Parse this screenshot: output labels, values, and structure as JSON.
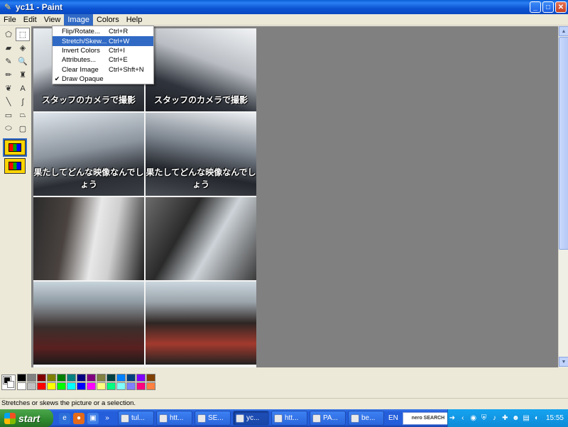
{
  "window": {
    "title": "yc11 - Paint",
    "controls": {
      "minimize": "_",
      "maximize": "□",
      "close": "✕"
    }
  },
  "menubar": [
    {
      "label": "File",
      "active": false
    },
    {
      "label": "Edit",
      "active": false
    },
    {
      "label": "View",
      "active": false
    },
    {
      "label": "Image",
      "active": true
    },
    {
      "label": "Colors",
      "active": false
    },
    {
      "label": "Help",
      "active": false
    }
  ],
  "image_menu": [
    {
      "label": "Flip/Rotate...",
      "shortcut": "Ctrl+R",
      "checked": false,
      "highlighted": false
    },
    {
      "label": "Stretch/Skew...",
      "shortcut": "Ctrl+W",
      "checked": false,
      "highlighted": true
    },
    {
      "label": "Invert Colors",
      "shortcut": "Ctrl+I",
      "checked": false,
      "highlighted": false
    },
    {
      "label": "Attributes...",
      "shortcut": "Ctrl+E",
      "checked": false,
      "highlighted": false
    },
    {
      "label": "Clear Image",
      "shortcut": "Ctrl+Shft+N",
      "checked": false,
      "highlighted": false
    },
    {
      "label": "Draw Opaque",
      "shortcut": "",
      "checked": true,
      "highlighted": false
    }
  ],
  "tools": [
    {
      "name": "free-form-select-icon",
      "glyph": "⬠",
      "selected": false
    },
    {
      "name": "rect-select-icon",
      "glyph": "⬚",
      "selected": true
    },
    {
      "name": "eraser-icon",
      "glyph": "▰",
      "selected": false
    },
    {
      "name": "fill-bucket-icon",
      "glyph": "◈",
      "selected": false
    },
    {
      "name": "pick-color-icon",
      "glyph": "✎",
      "selected": false
    },
    {
      "name": "magnifier-icon",
      "glyph": "🔍",
      "selected": false
    },
    {
      "name": "pencil-icon",
      "glyph": "✏",
      "selected": false
    },
    {
      "name": "brush-icon",
      "glyph": "♜",
      "selected": false
    },
    {
      "name": "airbrush-icon",
      "glyph": "❦",
      "selected": false
    },
    {
      "name": "text-icon",
      "glyph": "A",
      "selected": false
    },
    {
      "name": "line-icon",
      "glyph": "╲",
      "selected": false
    },
    {
      "name": "curve-icon",
      "glyph": "∫",
      "selected": false
    },
    {
      "name": "rectangle-icon",
      "glyph": "▭",
      "selected": false
    },
    {
      "name": "polygon-icon",
      "glyph": "⏢",
      "selected": false
    },
    {
      "name": "ellipse-icon",
      "glyph": "⬭",
      "selected": false
    },
    {
      "name": "rounded-rect-icon",
      "glyph": "▢",
      "selected": false
    }
  ],
  "captions": {
    "row1": "スタッフのカメラで撮影",
    "row2": "果たしてどんな映像なんでしょう"
  },
  "palette": {
    "foreground": "#000000",
    "background": "#ffffff",
    "colors": [
      "#000000",
      "#808080",
      "#800000",
      "#808000",
      "#008000",
      "#008080",
      "#000080",
      "#800080",
      "#808040",
      "#004040",
      "#0080ff",
      "#004080",
      "#8000ff",
      "#804000",
      "#ffffff",
      "#c0c0c0",
      "#ff0000",
      "#ffff00",
      "#00ff00",
      "#00ffff",
      "#0000ff",
      "#ff00ff",
      "#ffff80",
      "#00ff80",
      "#80ffff",
      "#8080ff",
      "#ff0080",
      "#ff8040"
    ]
  },
  "statusbar": {
    "text": "Stretches or skews the picture or a selection."
  },
  "taskbar": {
    "start_label": "start",
    "overflow": "»",
    "tasks": [
      {
        "label": "tul...",
        "active": false
      },
      {
        "label": "htt...",
        "active": false
      },
      {
        "label": "SE...",
        "active": false
      },
      {
        "label": "yc...",
        "active": true
      },
      {
        "label": "htt...",
        "active": false
      },
      {
        "label": "PA...",
        "active": false
      },
      {
        "label": "be...",
        "active": false
      }
    ],
    "language": "EN",
    "nero_label": "nero SEARCH",
    "clock": "15:55"
  }
}
